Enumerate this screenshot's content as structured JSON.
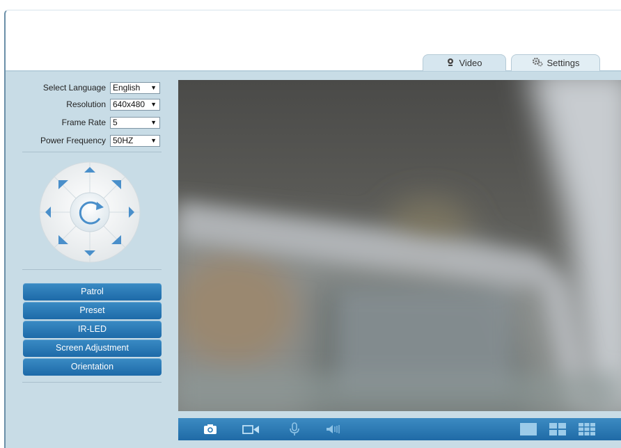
{
  "tabs": [
    {
      "label": "Video",
      "icon": "webcam-icon",
      "active": true
    },
    {
      "label": "Settings",
      "icon": "gears-icon",
      "active": false
    }
  ],
  "settings": {
    "language": {
      "label": "Select Language",
      "value": "English"
    },
    "resolution": {
      "label": "Resolution",
      "value": "640x480"
    },
    "frame_rate": {
      "label": "Frame Rate",
      "value": "5"
    },
    "power_frequency": {
      "label": "Power Frequency",
      "value": "50HZ"
    }
  },
  "ptz": {
    "directions": [
      "up",
      "up-right",
      "right",
      "down-right",
      "down",
      "down-left",
      "left",
      "up-left"
    ],
    "center": "rotate-icon"
  },
  "buttons": [
    "Patrol",
    "Preset",
    "IR-LED",
    "Screen Adjustment",
    "Orientation"
  ],
  "toolbar": {
    "icons": [
      "camera-snapshot-icon",
      "video-record-icon",
      "microphone-icon",
      "speaker-icon",
      "single-view-icon",
      "quad-view-icon",
      "nine-view-icon"
    ]
  },
  "colors": {
    "sidebar_bg": "#c8dce6",
    "button_blue": "#1d6aa8",
    "toolbar_blue": "#2a79b4"
  }
}
